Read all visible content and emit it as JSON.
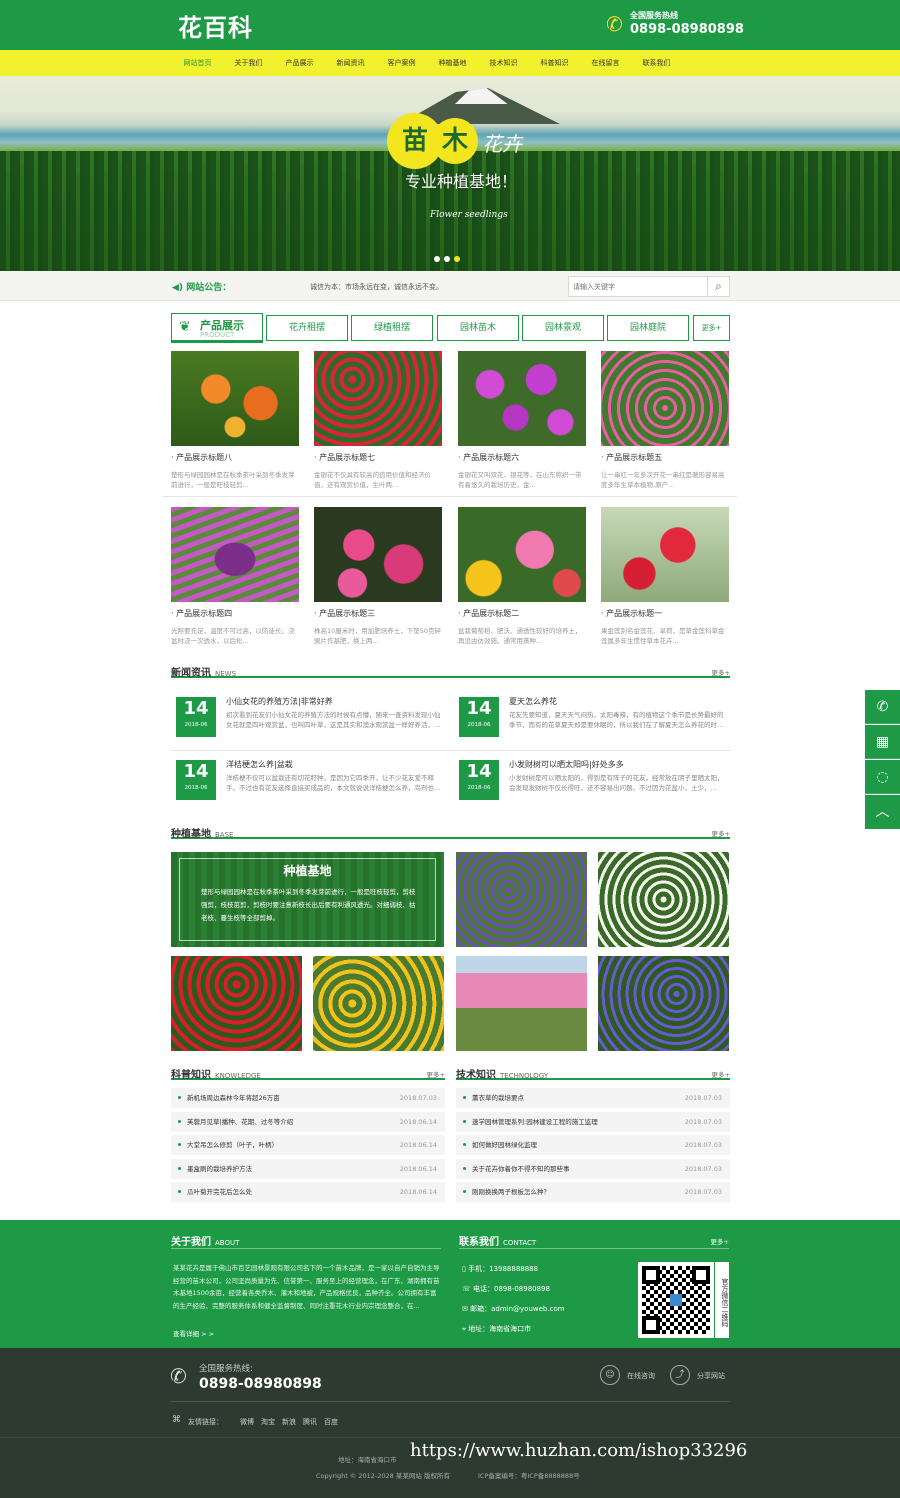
{
  "header": {
    "logo_text": "花百科",
    "hotline_label": "全国服务热线",
    "hotline_number": "0898-08980898"
  },
  "nav": [
    "网站首页",
    "关于我们",
    "产品展示",
    "新闻资讯",
    "客户案例",
    "种植基地",
    "技术知识",
    "科普知识",
    "在线留言",
    "联系我们"
  ],
  "banner": {
    "slogan_char1": "苗",
    "slogan_char2": "木",
    "slogan_cursive": "花卉",
    "slogan_sub": "专业种植基地！",
    "slogan_en": "Flower seedlings"
  },
  "notice": {
    "label": "网站公告：",
    "text": "诚信为本：市场永远在变，诚信永远不变。",
    "search_placeholder": "请输入关键字"
  },
  "products": {
    "title": "产品展示",
    "title_en": "PRODUCT",
    "tabs": [
      "花卉租摆",
      "绿植租摆",
      "园林苗木",
      "园林景观",
      "园林庭院"
    ],
    "more": "更多+",
    "items": [
      {
        "title": "· 产品展示标题八",
        "desc": "楚形与绿园园林是在秋季茶叶采到冬季发芽前进行，一般是旺枝轻剪..."
      },
      {
        "title": "· 产品展示标题七",
        "desc": "金银花不仅具有较高的药用价值和经济价值，还有观赏价值，生叶两..."
      },
      {
        "title": "· 产品展示标题六",
        "desc": "金银花又叫双花、银花等，在山东称织一带有着悠久的栽培历史。金..."
      },
      {
        "title": "· 产品展示标题五",
        "desc": "让一串红一年多次开花一串红是著形容易高度多年生草本植物,原产..."
      },
      {
        "title": "· 产品展示标题四",
        "desc": "光照要充足，温度不可过高，以防徒长。浇盆时浇一次透水，以后松..."
      },
      {
        "title": "· 产品展示标题三",
        "desc": "株高10厘米时，用加肥培养土，下垫50克碎豌片作基肥，换上两..."
      },
      {
        "title": "· 产品展示标题二",
        "desc": "盆栽葡萄稻、肥沃、通透性较好的培养土，再追由仿效施。通常用蒸种..."
      },
      {
        "title": "· 产品展示标题一",
        "desc": "果金莲别名金莲花、旱荷，是草金莲科草金莲属多年生惯性草本花卉..."
      }
    ]
  },
  "news": {
    "title": "新闻资讯",
    "title_en": "NEWS",
    "more": "更多+",
    "items": [
      {
        "day": "14",
        "ym": "2018-06",
        "title": "小仙女花的养殖方法|非常好养",
        "desc": "初次看到花友们小仙女花的养殖方法的时候有点懵，随来一查资料发现小仙女花就是四叶观赏盆，也叫四叶草，这是其实和澳水观赏盆一样好养活，..."
      },
      {
        "day": "14",
        "ym": "2018-06",
        "title": "夏天怎么养花",
        "desc": "花友先要知道，夏天天气闷热，太阳毒辣，有的植物这个季节是长势最好的季节，而有的花草夏天却是要休眠的，所以我们在了解夏天怎么养花的时..."
      },
      {
        "day": "14",
        "ym": "2018-06",
        "title": "洋桔梗怎么养|盆栽",
        "desc": "洋桔梗不仅可以盆栽还有切花籽种，是因为它四季开，让不少花友爱不释手。不过也有花友选择直接买成品的，本文就说说洋桔梗怎么养，鸟剂也..."
      },
      {
        "day": "14",
        "ym": "2018-06",
        "title": "小发财树可以晒太阳吗|好处多多",
        "desc": "小发财树是可以晒太阳的，得到是有阵子的花友，经常放在阴子里晒太阳，会发现发财树不仅长得旺，还不容易出问题。不过因为花盆小，土少，..."
      }
    ]
  },
  "base": {
    "title": "种植基地",
    "title_en": "BASE",
    "more": "更多+",
    "feature_title": "种植基地",
    "feature_desc": "楚形与绿园园林是在秋季茶叶采到冬季发芽前进行，一般是旺枝轻剪，剪枝强剪，枝枝茁剪，剪枝时要注意新枝长出后要有利通风透光。对细弱枝、枯老枝、蔓生枝等全部剪掉。"
  },
  "knowledge": {
    "title": "科普知识",
    "title_en": "KNOWLEDGE",
    "more": "更多+",
    "items": [
      {
        "title": "新机场周边森林今年将超26万亩",
        "date": "2018.07.03"
      },
      {
        "title": "芙蓉月见草|播种、花期、过冬等介绍",
        "date": "2018.06.14"
      },
      {
        "title": "大堂吊怎么修剪（叶子，叶柄）",
        "date": "2018.06.14"
      },
      {
        "title": "墨盒刷的栽培养护方法",
        "date": "2018.06.14"
      },
      {
        "title": "瓜叶菊开完花后怎么处",
        "date": "2018.06.14"
      }
    ]
  },
  "technology": {
    "title": "技术知识",
    "title_en": "TECHNOLOGY",
    "more": "更多+",
    "items": [
      {
        "title": "薰衣草的栽培要点",
        "date": "2018.07.03"
      },
      {
        "title": "速学园林管理系列:园林建设工程的施工监理",
        "date": "2018.07.03"
      },
      {
        "title": "如何做好园林绿化监理",
        "date": "2018.07.03"
      },
      {
        "title": "关于花卉你着你不得不知的那些事",
        "date": "2018.07.03"
      },
      {
        "title": "刚刚换换两子根板怎么种？",
        "date": "2018.07.03"
      }
    ]
  },
  "about": {
    "title": "关于我们",
    "title_en": "ABOUT",
    "text": "某某花卉是属于佛山市百艺园林景观有限公司名下的一个苗木品牌，是一家以自产自销为主导经营的苗木公司，公司坚尚质量为先、信誉第一、服务至上的经营理念，在广东、湖南拥有苗木基地1500余亩，经营着各类乔木、灌木和地被，产品规格优良，品种齐全。公司拥有丰富的生产经验、完整的服务体系和健全监督制度、同时注重花木行业内宗理念整合，在...",
    "detail": "查看详细 > >"
  },
  "contact": {
    "title": "联系我们",
    "title_en": "CONTACT",
    "more": "更多+",
    "phone": "手机：13988888888",
    "tel": "电话：0898-08980898",
    "email": "邮箱：admin@youweb.com",
    "address": "地址：海南省海口市",
    "qr_label": "官方微信二维码"
  },
  "footer": {
    "hotline_label": "全国服务热线:",
    "hotline_number": "0898-08980898",
    "consult": "在线咨询",
    "share": "分享网站",
    "links_label": "友情链接：",
    "links": [
      "微博",
      "淘宝",
      "新浪",
      "腾讯",
      "百度"
    ],
    "address_line": "地址：海南省海口市",
    "copyright": "Copyright © 2012-2028 某某网站 版权所有",
    "icp": "ICP备案编号：粤ICP备8888888号",
    "watermark": "https://www.huzhan.com/ishop33296"
  },
  "colors": {
    "brand": "#1e9a47",
    "nav_bg": "#f1f12d",
    "footer_bg": "#2d3a30"
  }
}
